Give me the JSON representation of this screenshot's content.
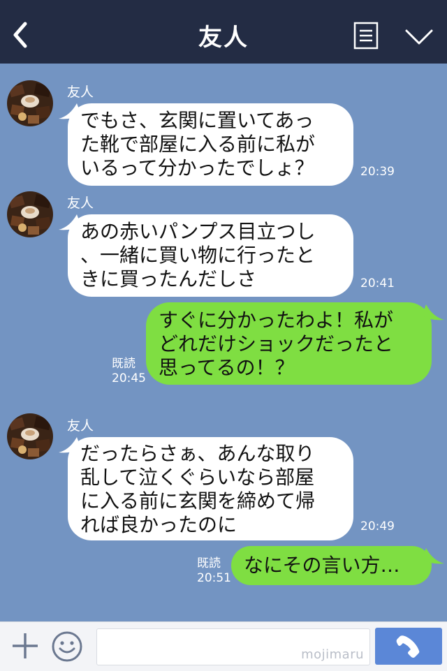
{
  "header": {
    "title": "友人"
  },
  "messages": [
    {
      "direction": "incoming",
      "sender": "友人",
      "text": "でもさ、玄関に置いてあっ\nた靴で部屋に入る前に私が\nいるって分かったでしょ？",
      "time": "20:39"
    },
    {
      "direction": "incoming",
      "sender": "友人",
      "text": "あの赤いパンプス目立つし\n、一緒に買い物に行ったと\nきに買ったんだしさ",
      "time": "20:41"
    },
    {
      "direction": "outgoing",
      "read": "既読",
      "text": "すぐに分かったわよ！私が\nどれだけショックだったと\n思ってるの！？",
      "time": "20:45"
    },
    {
      "direction": "incoming",
      "sender": "友人",
      "text": "だったらさぁ、あんな取り\n乱して泣くぐらいなら部屋\nに入る前に玄関を締めて帰\nれば良かったのに",
      "time": "20:49"
    },
    {
      "direction": "outgoing",
      "read": "既読",
      "text": "なにその言い方…",
      "time": "20:51"
    }
  ],
  "footer": {
    "input_value": "",
    "watermark": "mojimaru"
  },
  "icons": {
    "back": "chevron-left-icon",
    "menu": "document-list-icon",
    "collapse": "chevron-down-icon",
    "add": "plus-icon",
    "emoji": "smiley-icon",
    "call": "phone-icon",
    "avatar": "chocolates-avatar"
  },
  "colors": {
    "header_bg": "#232c44",
    "chat_bg": "#7394c2",
    "incoming_bubble": "#ffffff",
    "outgoing_bubble": "#7fde42",
    "call_button": "#5b87d7"
  }
}
